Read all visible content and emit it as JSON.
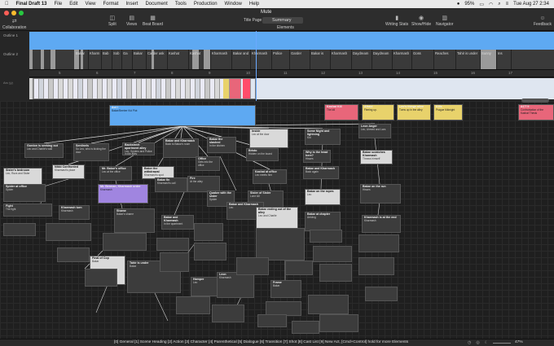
{
  "menubar": {
    "app": "Final Draft 13",
    "items": [
      "File",
      "Edit",
      "View",
      "Format",
      "Insert",
      "Document",
      "Tools",
      "Production",
      "Window",
      "Help"
    ],
    "battery": "95%",
    "clock": "Tue Aug 27  2:34"
  },
  "window": {
    "title": "Mute",
    "view_select": "Summary"
  },
  "toolbar": {
    "collaboration": "Collaboration",
    "split": "Split",
    "views": "Views",
    "beat_board": "Beat Board",
    "title_page": "Title Page",
    "elements": "Elements",
    "writing_stats": "Writing Stats",
    "show_hide": "Show/Hide",
    "navigator": "Navigator",
    "feedback": "Feedback"
  },
  "outline": {
    "row1_label": "Outline 1",
    "row2_label": "Outline 2",
    "arcs_label": "Arc (y)",
    "segments": [
      "Bakar",
      "Kharm",
      "Bab",
      "Sob",
      "Ga",
      "Bakar",
      "Carder ask",
      "Kashat",
      "Kashat",
      "Kharmash",
      "Bakar and",
      "Kharmash",
      "Police",
      "Garder",
      "Bakar is",
      "Kharmash",
      "Daydream",
      "Daydream",
      "Kharmash",
      "Goss",
      "Reaches",
      "Tahir is under",
      "Sunny",
      "Ins"
    ],
    "ruler": [
      "5",
      "6",
      "7",
      "8",
      "9",
      "10",
      "11",
      "12",
      "13",
      "14",
      "15",
      "16",
      "17"
    ]
  },
  "beatboard": {
    "top_cards": [
      {
        "title": "Act I",
        "text": "Bakar/Beeber Kid Plot"
      },
      {
        "title": "Kashat Kill",
        "text": "The kill"
      },
      {
        "title": "Afraid",
        "text": "Fleeing up."
      },
      {
        "title": "Leo's things alive",
        "text": "Turns up in the alley"
      },
      {
        "title": "Kills",
        "text": "Prague Midnight"
      },
      {
        "title": "ACT II",
        "text": "Confrontation of the Kashat Thesis"
      }
    ],
    "cards": [
      {
        "title": "Sentinels",
        "text": "So Leo, who is kicking the door"
      },
      {
        "title": "Backstreet apartment alley",
        "text": "Leo, Spiders and Police in the alley"
      },
      {
        "title": "Bakar and Kharmash",
        "text": "Back to Bakar's room"
      },
      {
        "title": "Bakar the slashed",
        "text": "In the kitchen"
      },
      {
        "title": "Inside",
        "text": "Leo at the door"
      },
      {
        "title": "Some Night and lightning",
        "text": "Kid"
      },
      {
        "title": "Leon Anger",
        "text": "Leo, Ahmed and Lars"
      },
      {
        "title": "Gordon is seeking out",
        "text": "Leo and Charlie's wall"
      },
      {
        "title": "Nikki Confronted",
        "text": "Kharmash's place"
      },
      {
        "title": "Mr. Bakar's office",
        "text": "Leo at the office"
      },
      {
        "title": "Baker the withdrawal",
        "text": "Kharmash's spot"
      },
      {
        "title": "Bristo",
        "text": "Hidden on the board"
      },
      {
        "title": "Office",
        "text": "Gets into the office"
      },
      {
        "title": "Kashat at office",
        "text": "Leo meets him"
      },
      {
        "title": "Why is the head here?",
        "text": "Hisses"
      },
      {
        "title": "Bakar and Kharmash",
        "text": "Back again"
      },
      {
        "title": "Bakar scratches Kharmash",
        "text": "Throws himself"
      },
      {
        "title": "Sister's bedroom",
        "text": "Leo, Rozs and Sister"
      },
      {
        "title": "Spider at office",
        "text": "Spider"
      },
      {
        "title": "Mr. Berman, Kharmash order",
        "text": "Kharmash"
      },
      {
        "title": "Bakar fin",
        "text": "Kharmash's call"
      },
      {
        "title": "Fire",
        "text": "At the alley"
      },
      {
        "title": "Quaker with the sister",
        "text": "Spider"
      },
      {
        "title": "Sister of Sister",
        "text": "Lone kill"
      },
      {
        "title": "Bakar on the ropes",
        "text": "Leo"
      },
      {
        "title": "Bakar on the run",
        "text": "Hisses"
      },
      {
        "title": "Fight",
        "text": "The fight"
      },
      {
        "title": "Kharmash turn",
        "text": "Kharmash"
      },
      {
        "title": "Shame",
        "text": "Bakar's shame"
      },
      {
        "title": "Bakar and Kharmash",
        "text": "In the apartment"
      },
      {
        "title": "Bakar and Kharmash",
        "text": "Leo"
      },
      {
        "title": "Bakar ending out of the alley",
        "text": "Leo and Charlie"
      },
      {
        "title": "Bakar at chapter",
        "text": "Arriving"
      },
      {
        "title": "Kharmash is at the end",
        "text": "Kharmash"
      },
      {
        "title": "Final of Cop",
        "text": "Bakar"
      },
      {
        "title": "Tahir is under",
        "text": "Bakar"
      },
      {
        "title": "Hamper",
        "text": "Leo"
      },
      {
        "title": "Leon",
        "text": "Kharmash"
      },
      {
        "title": "Frame",
        "text": "Bakar"
      }
    ]
  },
  "status": {
    "hint": "[0] General [1] Scene Heading [2] Action [3] Character [4] Parenthetical [5] Dialogue [6] Transition [7] Shot [8] Cast List [9] New Act, [Cmd+Control] hold for more Elements",
    "zoom": "47%"
  },
  "colors": {
    "accent": "#5ea9f2",
    "pink": "#e8667a",
    "yellow": "#e8d26b",
    "purple": "#a085e0"
  }
}
